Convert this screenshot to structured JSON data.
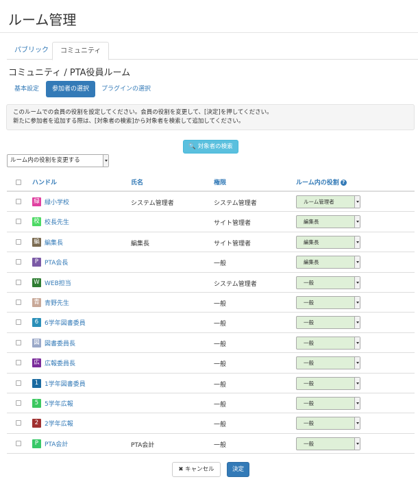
{
  "page": {
    "title": "ルーム管理"
  },
  "tabs": [
    {
      "label": "パブリック",
      "active": false
    },
    {
      "label": "コミュニティ",
      "active": true
    }
  ],
  "section_title": "コミュニティ / PTA役員ルーム",
  "pills": [
    {
      "label": "基本設定",
      "active": false
    },
    {
      "label": "参加者の選択",
      "active": true
    },
    {
      "label": "プラグインの選択",
      "active": false
    }
  ],
  "notice": {
    "line1": "このルームでの会員の役割を設定してください。会員の役割を変更して、[決定]を押してください。",
    "line2": "新たに参加者を追加する際は、[対象者の検索]から対象者を検索して追加してください。"
  },
  "search_button": {
    "label": "対象者の検索"
  },
  "bulk_role_select": {
    "value": "ルーム内の役割を変更する"
  },
  "table": {
    "headers": {
      "handle": "ハンドル",
      "name": "氏名",
      "permission": "権限",
      "room_role": "ルーム内の役割"
    },
    "rows": [
      {
        "avatar": "緑",
        "avatar_color": "#e040a0",
        "handle": "緑小学校",
        "name": "システム管理者",
        "permission": "システム管理者",
        "role": "ルーム管理者"
      },
      {
        "avatar": "校",
        "avatar_color": "#4cd964",
        "handle": "校長先生",
        "name": "",
        "permission": "サイト管理者",
        "role": "編集長"
      },
      {
        "avatar": "編",
        "avatar_color": "#7a6a50",
        "handle": "編集長",
        "name": "編集長",
        "permission": "サイト管理者",
        "role": "編集長"
      },
      {
        "avatar": "P",
        "avatar_color": "#7b5aa6",
        "handle": "PTA会長",
        "name": "",
        "permission": "一般",
        "role": "編集長"
      },
      {
        "avatar": "W",
        "avatar_color": "#2e7d32",
        "handle": "WEB担当",
        "name": "",
        "permission": "システム管理者",
        "role": "一般"
      },
      {
        "avatar": "青",
        "avatar_color": "#c8a898",
        "handle": "青野先生",
        "name": "",
        "permission": "一般",
        "role": "一般"
      },
      {
        "avatar": "6",
        "avatar_color": "#2a8fb8",
        "handle": "6学年図書委員",
        "name": "",
        "permission": "一般",
        "role": "一般"
      },
      {
        "avatar": "図",
        "avatar_color": "#9aa8c8",
        "handle": "図書委員長",
        "name": "",
        "permission": "一般",
        "role": "一般"
      },
      {
        "avatar": "広",
        "avatar_color": "#7a2a9a",
        "handle": "広報委員長",
        "name": "",
        "permission": "一般",
        "role": "一般"
      },
      {
        "avatar": "1",
        "avatar_color": "#1a6aa0",
        "handle": "1学年図書委員",
        "name": "",
        "permission": "一般",
        "role": "一般"
      },
      {
        "avatar": "5",
        "avatar_color": "#3cc860",
        "handle": "5学年広報",
        "name": "",
        "permission": "一般",
        "role": "一般"
      },
      {
        "avatar": "2",
        "avatar_color": "#a03030",
        "handle": "2学年広報",
        "name": "",
        "permission": "一般",
        "role": "一般"
      },
      {
        "avatar": "P",
        "avatar_color": "#38c868",
        "handle": "PTA会計",
        "name": "PTA会計",
        "permission": "一般",
        "role": "一般"
      }
    ]
  },
  "footer": {
    "cancel_label": "キャンセル",
    "submit_label": "決定"
  }
}
